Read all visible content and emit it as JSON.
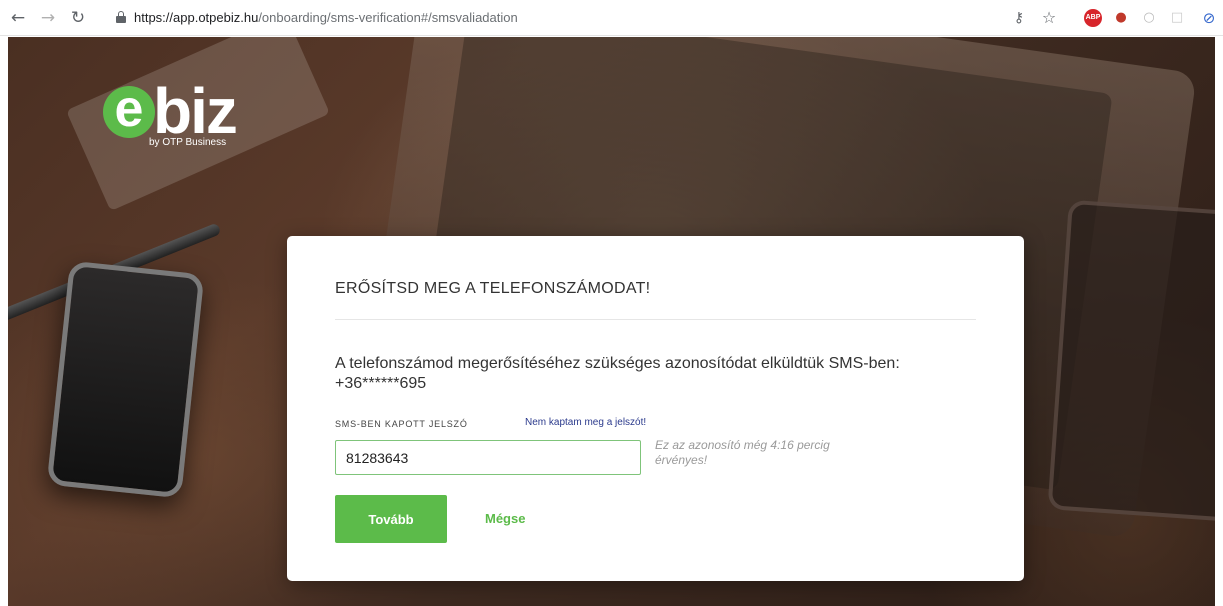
{
  "browser": {
    "url_host": "https://app.otpebiz.hu",
    "url_path": "/onboarding/sms-verification#/smsvaliadation",
    "abp_label": "ABP"
  },
  "logo": {
    "e": "e",
    "rest": "biz",
    "sub": "by OTP Business"
  },
  "card": {
    "title": "ERŐSÍTSD MEG A TELEFONSZÁMODAT!",
    "description": "A telefonszámod megerősítéséhez szükséges azonosítódat elküldtük SMS-ben: +36******695",
    "field_label": "SMS-BEN KAPOTT JELSZÓ",
    "resend_link": "Nem kaptam meg a jelszót!",
    "code_value": "81283643",
    "validity_note": "Ez az azonosító még 4:16 percig érvényes!",
    "next_button": "Tovább",
    "cancel_button": "Mégse"
  },
  "colors": {
    "accent": "#5cbb4a",
    "link": "#2b3a8c",
    "abp_red": "#d7252b"
  }
}
